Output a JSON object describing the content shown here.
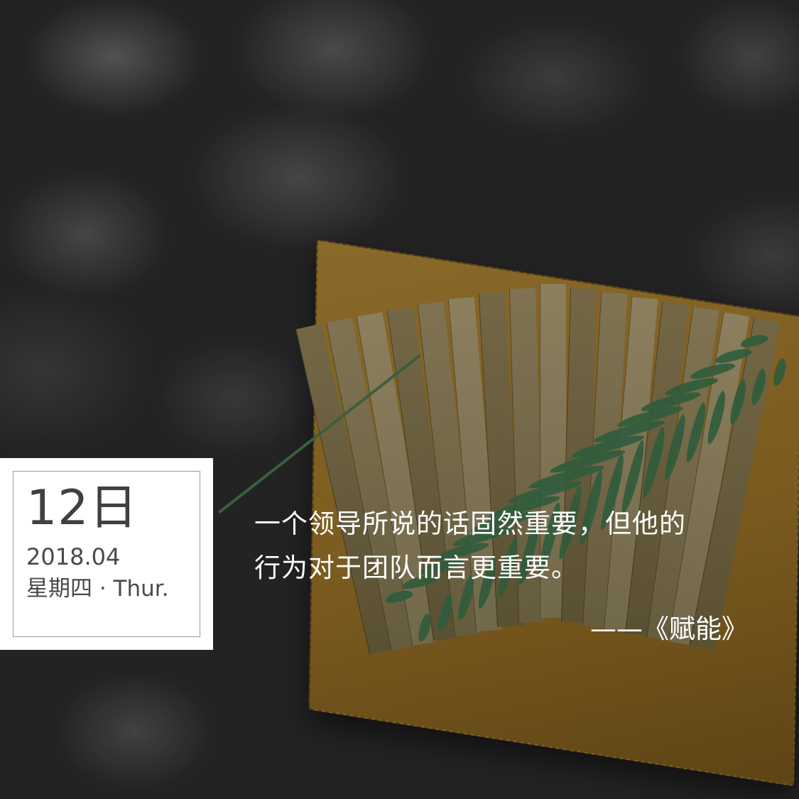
{
  "date": {
    "day": "12日",
    "year_month": "2018.04",
    "weekday": "星期四 · Thur."
  },
  "quote": {
    "line1": "一个领导所说的话固然重要，但他的",
    "line2": "行为对于团队而言更重要。",
    "source": "——《赋能》"
  },
  "colors": {
    "text": "#ffffff",
    "card_background": "#ffffff",
    "card_text": "#404040",
    "book": "#8a6a2a",
    "fern": "#2f5c3c"
  }
}
